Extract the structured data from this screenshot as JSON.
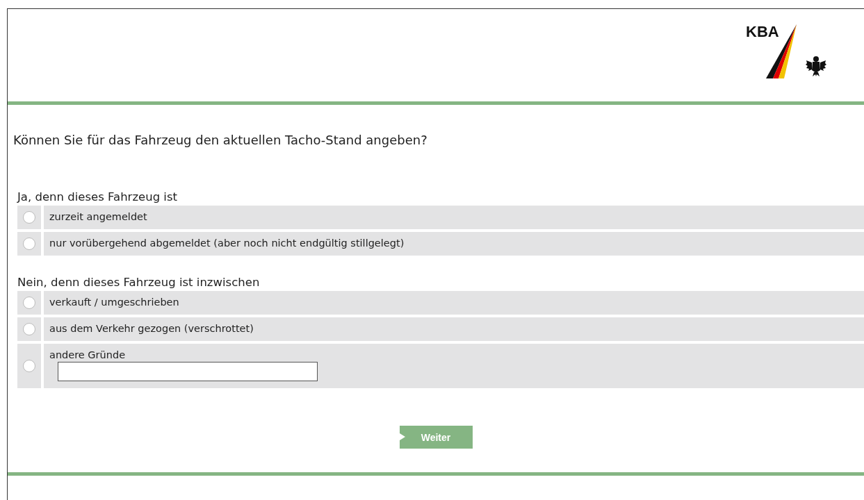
{
  "header": {
    "logo_text": "KBA"
  },
  "question": "Können Sie für das Fahrzeug den aktuellen Tacho-Stand angeben?",
  "groups": [
    {
      "heading": "Ja, denn dieses Fahrzeug ist",
      "options": [
        {
          "label": "zurzeit angemeldet",
          "kind": "plain",
          "selected": false
        },
        {
          "label": "nur vorübergehend abgemeldet (aber noch nicht endgültig stillgelegt)",
          "kind": "plain",
          "selected": false
        }
      ]
    },
    {
      "heading": "Nein, denn dieses Fahrzeug ist inzwischen",
      "options": [
        {
          "label": "verkauft / umgeschrieben",
          "kind": "plain",
          "selected": false
        },
        {
          "label": "aus dem Verkehr gezogen (verschrottet)",
          "kind": "plain",
          "selected": false
        },
        {
          "label": "andere Gründe",
          "kind": "with-field",
          "selected": false
        }
      ]
    }
  ],
  "submit": {
    "label": "Weiter"
  }
}
